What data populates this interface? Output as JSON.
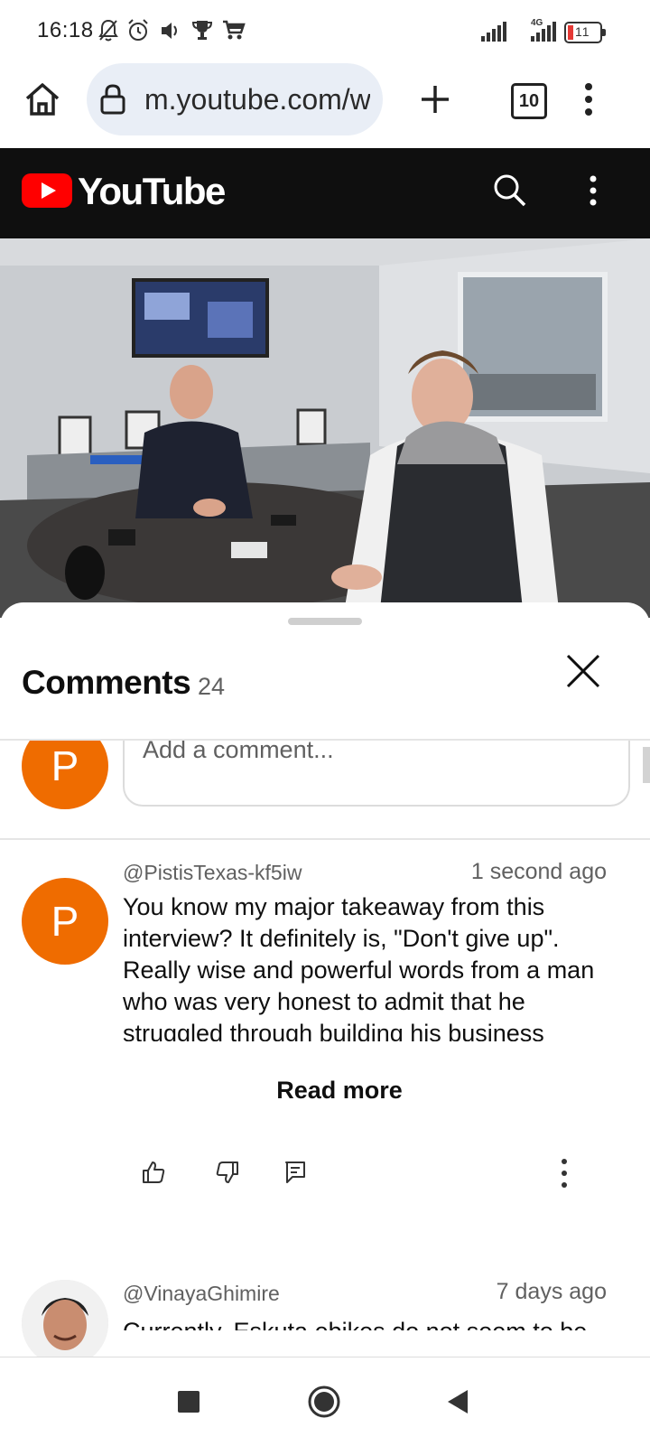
{
  "status_bar": {
    "time": "16:18",
    "network_label": "4G",
    "battery": "11"
  },
  "browser": {
    "url": "m.youtube.com/w",
    "tab_count": "10"
  },
  "youtube": {
    "wordmark": "YouTube",
    "brand_color": "#ff0000"
  },
  "comments": {
    "title": "Comments",
    "count": "24",
    "input_avatar_letter": "P",
    "input_placeholder": "Add a comment...",
    "items": [
      {
        "avatar_letter": "P",
        "author": "@PistisTexas-kf5iw",
        "time": "1 second ago",
        "text": "You know my major takeaway from this interview? It definitely is, \"Don't give up\". Really wise and powerful words from a man who was very honest to admit that he struggled through building his business",
        "read_more": "Read more"
      },
      {
        "author": "@VinayaGhimire",
        "time": "7 days ago",
        "text": "Currently, Eskuta ebikes do not seem to be"
      }
    ]
  },
  "colors": {
    "avatar_orange": "#ef6c00",
    "header_black": "#0f0f0f",
    "url_pill": "#e9eef6"
  }
}
